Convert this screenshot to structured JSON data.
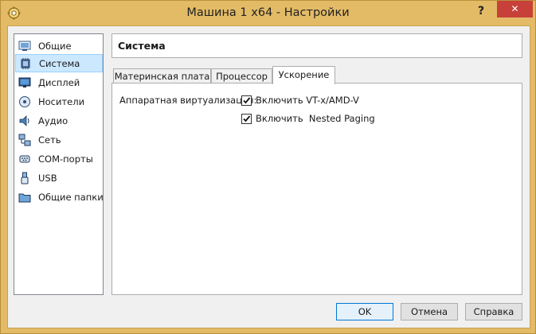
{
  "window": {
    "title": "Машина 1 x64 - Настройки",
    "help_label": "?",
    "close_label": "✕"
  },
  "sidebar": {
    "items": [
      {
        "label": "Общие",
        "icon": "general-icon"
      },
      {
        "label": "Система",
        "icon": "system-icon",
        "selected": true
      },
      {
        "label": "Дисплей",
        "icon": "display-icon"
      },
      {
        "label": "Носители",
        "icon": "storage-icon"
      },
      {
        "label": "Аудио",
        "icon": "audio-icon"
      },
      {
        "label": "Сеть",
        "icon": "network-icon"
      },
      {
        "label": "COM-порты",
        "icon": "serial-ports-icon"
      },
      {
        "label": "USB",
        "icon": "usb-icon"
      },
      {
        "label": "Общие папки",
        "icon": "shared-folders-icon"
      }
    ]
  },
  "section": {
    "title": "Система"
  },
  "tabs": [
    {
      "label": "Материнская плата",
      "active": false
    },
    {
      "label": "Процессор",
      "active": false
    },
    {
      "label": "Ускорение",
      "active": true
    }
  ],
  "acceleration": {
    "label": "Аппаратная виртуализация:",
    "options": [
      {
        "label": "Включить VT-x/AMD-V",
        "checked": true
      },
      {
        "label": "Включить  Nested Paging",
        "checked": true
      }
    ]
  },
  "buttons": {
    "ok": "OK",
    "cancel": "Отмена",
    "help": "Справка"
  },
  "colors": {
    "frame": "#e3bb66",
    "close": "#c7403a",
    "selection": "#cce8ff",
    "default_button_border": "#0078d7"
  }
}
